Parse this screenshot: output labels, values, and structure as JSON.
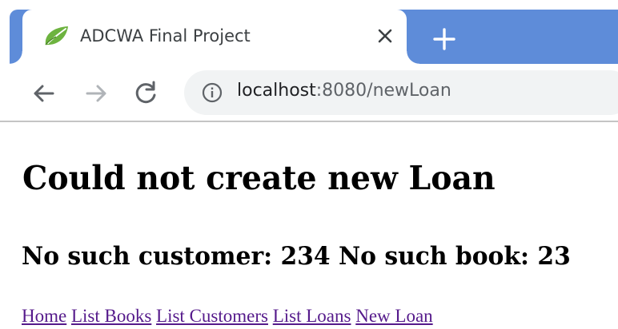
{
  "browser": {
    "tab": {
      "title": "ADCWA Final Project",
      "favicon": "spring-leaf-icon"
    },
    "accent_color": "#5e8cd9",
    "toolbar": {
      "back": "arrow-left-icon",
      "forward": "arrow-right-icon",
      "reload": "reload-icon"
    },
    "url": {
      "host": "localhost",
      "rest": ":8080/newLoan"
    }
  },
  "page": {
    "heading": "Could not create new Loan",
    "error_message": "No such customer: 234 No such book: 23",
    "nav": [
      {
        "label": "Home"
      },
      {
        "label": "List Books"
      },
      {
        "label": "List Customers"
      },
      {
        "label": "List Loans"
      },
      {
        "label": "New Loan"
      }
    ],
    "link_color": "#551a8b"
  }
}
